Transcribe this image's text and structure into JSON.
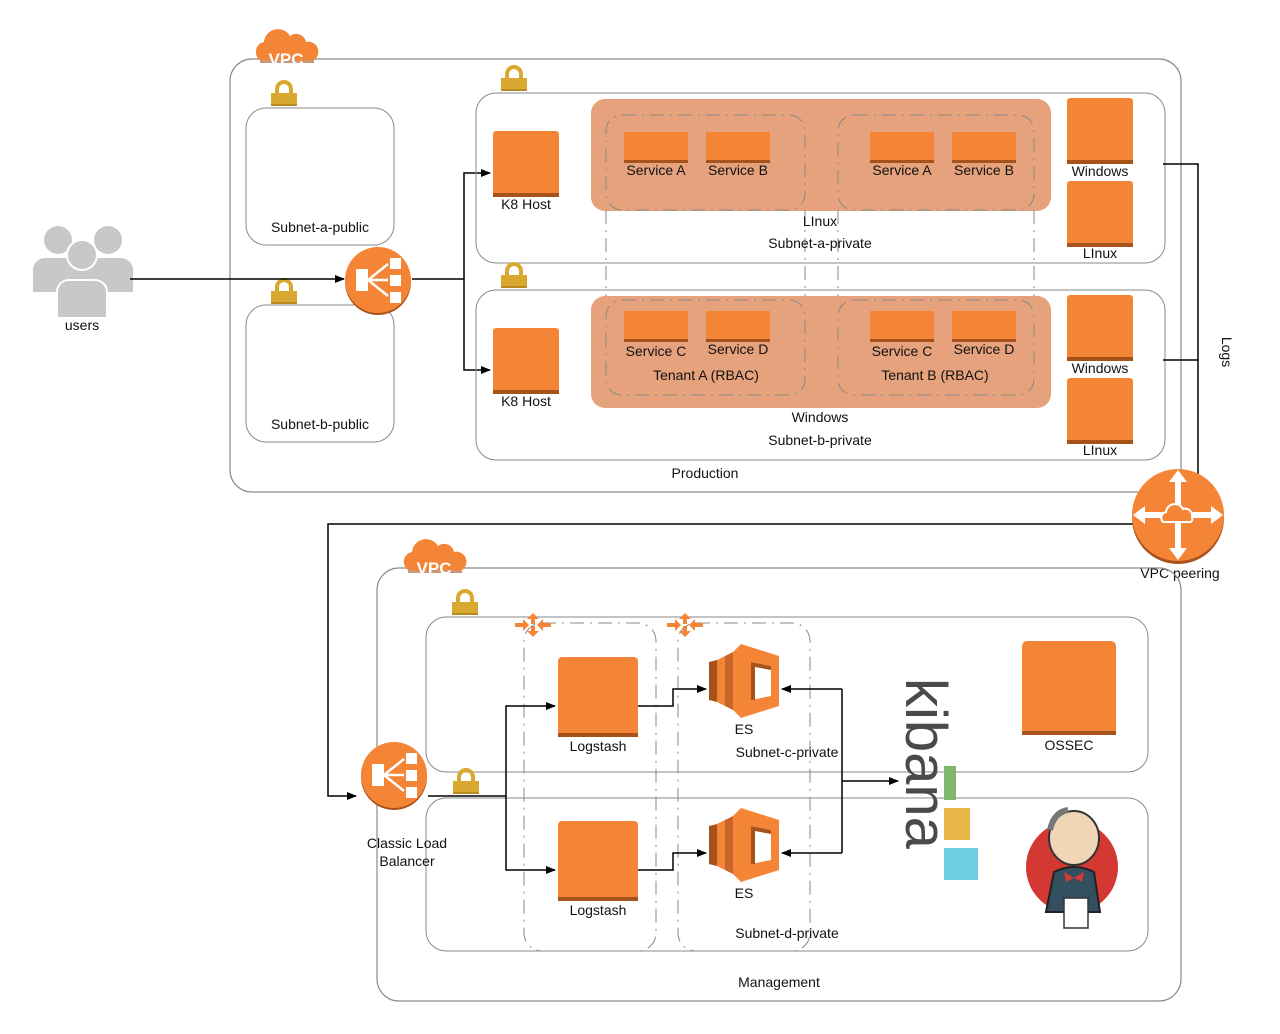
{
  "colors": {
    "orange": "#f58536",
    "orange_dark": "#a8521b",
    "tenant_fill": "#e5a27c",
    "lock": "#d9a830",
    "border": "#8a8a8a",
    "users": "#c8c8c8"
  },
  "users": {
    "label": "users",
    "icon": "users-icon"
  },
  "production": {
    "vpc_label": "VPC",
    "title": "Production",
    "public_subnets": [
      {
        "label": "Subnet-a-public"
      },
      {
        "label": "Subnet-b-public"
      }
    ],
    "private_subnets": [
      {
        "label": "Subnet-a-private",
        "host_label": "K8 Host",
        "group_os_label": "LInux",
        "tenants": [
          {
            "label": "",
            "services": [
              "Service A",
              "Service B"
            ]
          },
          {
            "label": "",
            "services": [
              "Service A",
              "Service B"
            ]
          }
        ],
        "nodes": [
          "Windows",
          "LInux"
        ]
      },
      {
        "label": "Subnet-b-private",
        "host_label": "K8 Host",
        "group_os_label": "Windows",
        "tenants": [
          {
            "label": "Tenant A (RBAC)",
            "services": [
              "Service C",
              "Service D"
            ]
          },
          {
            "label": "Tenant B (RBAC)",
            "services": [
              "Service C",
              "Service D"
            ]
          }
        ],
        "nodes": [
          "Windows",
          "LInux"
        ]
      }
    ]
  },
  "peering": {
    "label": "VPC peering",
    "logs_label": "Logs"
  },
  "management": {
    "vpc_label": "VPC",
    "title": "Management",
    "load_balancer_label_1": "Classic Load",
    "load_balancer_label_2": "Balancer",
    "subnets": [
      {
        "label": "Subnet-c-private",
        "logstash": "Logstash",
        "es": "ES"
      },
      {
        "label": "Subnet-d-private",
        "logstash": "Logstash",
        "es": "ES"
      }
    ],
    "kibana_label": "kibana",
    "ossec_label": "OSSEC",
    "jenkins_icon": "jenkins-icon"
  }
}
